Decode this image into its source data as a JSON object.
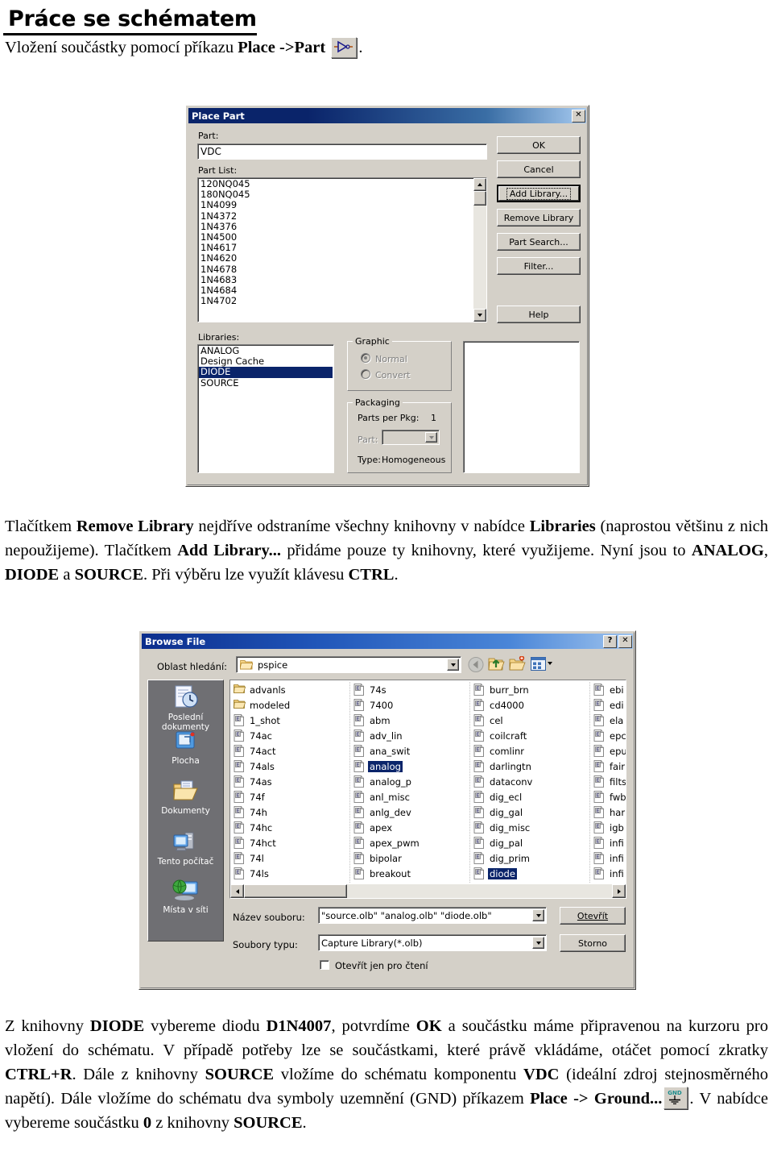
{
  "document": {
    "heading": "Práce se schématem",
    "intro_pre": "Vložení součástky pomocí příkazu ",
    "intro_bold": "Place ->Part",
    "intro_post": ".",
    "para_mid": "Tlačítkem <b>Remove Library</b> nejdříve odstraníme všechny knihovny v nabídce <b>Libraries</b> (naprostou většinu z nich nepoužijeme). Tlačítkem <b>Add Library...</b> přidáme pouze ty knihovny, které využijeme. Nyní jsou to <b>ANALOG</b>, <b>DIODE</b> a <b>SOURCE</b>. Při výběru lze využít klávesu <b>CTRL</b>.",
    "para_bottom_1": "Z knihovny <b>DIODE</b> vybereme diodu <b>D1N4007</b>, potvrdíme <b>OK</b> a součástku máme připravenou na kurzoru pro vložení do schématu. V případě potřeby lze se součástkami, které právě vkládáme, otáčet pomocí zkratky <b>CTRL+R</b>. Dále z knihovny <b>SOURCE</b> vložíme do schématu komponentu <b>VDC</b> (ideální zdroj stejnosměrného napětí). Dále vložíme do schématu dva symboly uzemnění (GND) příkazem <b>Place -> Ground...</b>",
    "para_bottom_2": ". V nabídce vybereme součástku <b>0</b> z knihovny <b>SOURCE</b>.",
    "inline_icons": {
      "place_part": "place-part-toolbar-icon",
      "place_ground": "place-ground-toolbar-icon",
      "ground_label": "GND"
    }
  },
  "place_part_dialog": {
    "title": "Place Part",
    "close_label": "✕",
    "part_label": "Part:",
    "part_value": "VDC",
    "part_list_label": "Part List:",
    "part_list": [
      "120NQ045",
      "180NQ045",
      "1N4099",
      "1N4372",
      "1N4376",
      "1N4500",
      "1N4617",
      "1N4620",
      "1N4678",
      "1N4683",
      "1N4684",
      "1N4702"
    ],
    "libraries_label": "Libraries:",
    "libraries": [
      "ANALOG",
      "Design Cache",
      "DIODE",
      "SOURCE"
    ],
    "libraries_selected": "DIODE",
    "buttons": {
      "ok": "OK",
      "cancel": "Cancel",
      "add_library": "Add Library...",
      "remove_library": "Remove Library",
      "part_search": "Part Search...",
      "filter": "Filter...",
      "help": "Help"
    },
    "graphic_group": {
      "label": "Graphic",
      "normal": "Normal",
      "convert": "Convert",
      "selected": "Normal"
    },
    "packaging_group": {
      "label": "Packaging",
      "parts_per_pkg_label": "Parts per Pkg:",
      "parts_per_pkg_value": "1",
      "part_label": "Part:",
      "part_value": "",
      "type_label": "Type:",
      "type_value": "Homogeneous"
    }
  },
  "browse_file_dialog": {
    "title": "Browse File",
    "help_label": "?",
    "close_label": "✕",
    "lookin_label": "Oblast hledání:",
    "lookin_value": "pspice",
    "toolbar_icons": [
      "back-icon",
      "up-one-level-icon",
      "new-folder-icon",
      "views-icon"
    ],
    "places": [
      {
        "label": "Poslední dokumenty",
        "icon": "recent-documents-icon"
      },
      {
        "label": "Plocha",
        "icon": "desktop-icon"
      },
      {
        "label": "Dokumenty",
        "icon": "my-documents-icon"
      },
      {
        "label": "Tento počítač",
        "icon": "my-computer-icon"
      },
      {
        "label": "Místa v síti",
        "icon": "network-places-icon"
      }
    ],
    "file_columns": [
      {
        "items": [
          {
            "name": "advanls",
            "type": "folder"
          },
          {
            "name": "modeled",
            "type": "folder"
          },
          {
            "name": "1_shot",
            "type": "file"
          },
          {
            "name": "74ac",
            "type": "file"
          },
          {
            "name": "74act",
            "type": "file"
          },
          {
            "name": "74als",
            "type": "file"
          },
          {
            "name": "74as",
            "type": "file"
          },
          {
            "name": "74f",
            "type": "file"
          },
          {
            "name": "74h",
            "type": "file"
          },
          {
            "name": "74hc",
            "type": "file"
          },
          {
            "name": "74hct",
            "type": "file"
          },
          {
            "name": "74l",
            "type": "file"
          },
          {
            "name": "74ls",
            "type": "file"
          }
        ]
      },
      {
        "items": [
          {
            "name": "74s",
            "type": "file"
          },
          {
            "name": "7400",
            "type": "file"
          },
          {
            "name": "abm",
            "type": "file"
          },
          {
            "name": "adv_lin",
            "type": "file"
          },
          {
            "name": "ana_swit",
            "type": "file"
          },
          {
            "name": "analog",
            "type": "file",
            "selected": true
          },
          {
            "name": "analog_p",
            "type": "file"
          },
          {
            "name": "anl_misc",
            "type": "file"
          },
          {
            "name": "anlg_dev",
            "type": "file"
          },
          {
            "name": "apex",
            "type": "file"
          },
          {
            "name": "apex_pwm",
            "type": "file"
          },
          {
            "name": "bipolar",
            "type": "file"
          },
          {
            "name": "breakout",
            "type": "file"
          }
        ]
      },
      {
        "items": [
          {
            "name": "burr_brn",
            "type": "file"
          },
          {
            "name": "cd4000",
            "type": "file"
          },
          {
            "name": "cel",
            "type": "file"
          },
          {
            "name": "coilcraft",
            "type": "file"
          },
          {
            "name": "comlinr",
            "type": "file"
          },
          {
            "name": "darlingtn",
            "type": "file"
          },
          {
            "name": "dataconv",
            "type": "file"
          },
          {
            "name": "dig_ecl",
            "type": "file"
          },
          {
            "name": "dig_gal",
            "type": "file"
          },
          {
            "name": "dig_misc",
            "type": "file"
          },
          {
            "name": "dig_pal",
            "type": "file"
          },
          {
            "name": "dig_prim",
            "type": "file"
          },
          {
            "name": "diode",
            "type": "file",
            "selected": true
          }
        ]
      },
      {
        "items": [
          {
            "name": "ebi",
            "type": "file"
          },
          {
            "name": "edi",
            "type": "file"
          },
          {
            "name": "ela",
            "type": "file"
          },
          {
            "name": "epc",
            "type": "file"
          },
          {
            "name": "epu",
            "type": "file"
          },
          {
            "name": "fair",
            "type": "file"
          },
          {
            "name": "filts",
            "type": "file"
          },
          {
            "name": "fwb",
            "type": "file"
          },
          {
            "name": "har",
            "type": "file"
          },
          {
            "name": "igb",
            "type": "file"
          },
          {
            "name": "infi",
            "type": "file"
          },
          {
            "name": "infi",
            "type": "file"
          },
          {
            "name": "infi",
            "type": "file"
          }
        ]
      }
    ],
    "filename_label": "Název souboru:",
    "filename_value": "\"source.olb\" \"analog.olb\" \"diode.olb\"",
    "filetype_label": "Soubory typu:",
    "filetype_value": "Capture Library(*.olb)",
    "readonly_label": "Otevřít jen pro čtení",
    "open_button": "Otevřít",
    "cancel_button": "Storno"
  },
  "colors": {
    "dialog_face": "#d4d0c8",
    "titlebar_start": "#0a246a",
    "titlebar_end": "#a6caf0",
    "selection": "#0a246a",
    "places_bar": "#6f6f73",
    "folder_yellow": "#f5d580"
  }
}
